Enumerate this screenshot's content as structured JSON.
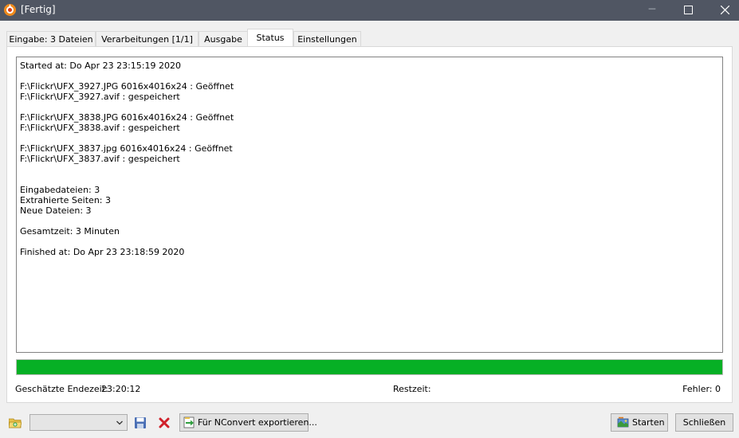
{
  "window": {
    "title": "[Fertig]"
  },
  "tabs": [
    {
      "label": "Eingabe: 3 Dateien",
      "active": false
    },
    {
      "label": "Verarbeitungen [1/1]",
      "active": false
    },
    {
      "label": "Ausgabe",
      "active": false
    },
    {
      "label": "Status",
      "active": true
    },
    {
      "label": "Einstellungen",
      "active": false
    }
  ],
  "log": {
    "text": "Started at: Do Apr 23 23:15:19 2020\n\nF:\\Flickr\\UFX_3927.JPG 6016x4016x24 : Geöffnet\nF:\\Flickr\\UFX_3927.avif : gespeichert\n\nF:\\Flickr\\UFX_3838.JPG 6016x4016x24 : Geöffnet\nF:\\Flickr\\UFX_3838.avif : gespeichert\n\nF:\\Flickr\\UFX_3837.jpg 6016x4016x24 : Geöffnet\nF:\\Flickr\\UFX_3837.avif : gespeichert\n\n\nEingabedateien: 3\nExtrahierte Seiten: 3\nNeue Dateien: 3\n\nGesamtzeit: 3 Minuten\n\nFinished at: Do Apr 23 23:18:59 2020"
  },
  "progress": {
    "percent": 100,
    "color": "#06b025"
  },
  "status": {
    "eta_label": "Geschätzte Endezeit:",
    "eta_value": "23:20:12",
    "remaining_label": "Restzeit:",
    "errors_label": "Fehler:  0"
  },
  "bottom": {
    "combo_value": "",
    "export_label": "Für NConvert exportieren...",
    "start_label": "Starten",
    "close_label": "Schließen"
  },
  "icons": {
    "app": "xnview-app-icon",
    "folder": "open-folder-icon",
    "save": "save-disk-icon",
    "delete": "red-x-delete-icon",
    "export": "export-script-icon",
    "start": "start-convert-icon"
  }
}
